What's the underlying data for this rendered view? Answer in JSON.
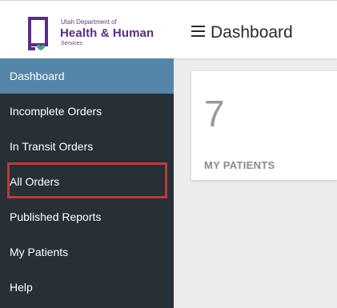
{
  "logo": {
    "line1": "Utah Department of",
    "line2": "Health & Human",
    "line3": "Services",
    "colors": {
      "primary": "#5b2d82",
      "accent": "#3fa68a"
    }
  },
  "header": {
    "menu_icon": "hamburger-menu-icon",
    "title": "Dashboard"
  },
  "sidebar": {
    "items": [
      {
        "label": "Dashboard",
        "active": true
      },
      {
        "label": "Incomplete Orders"
      },
      {
        "label": "In Transit Orders"
      },
      {
        "label": "All Orders",
        "highlighted": true
      },
      {
        "label": "Published Reports"
      },
      {
        "label": "My Patients"
      },
      {
        "label": "Help"
      }
    ],
    "colors": {
      "background": "#263036",
      "active": "#5585a8",
      "highlight": "#bb3b3b"
    }
  },
  "main": {
    "card": {
      "value": "7",
      "label": "MY PATIENTS"
    }
  }
}
